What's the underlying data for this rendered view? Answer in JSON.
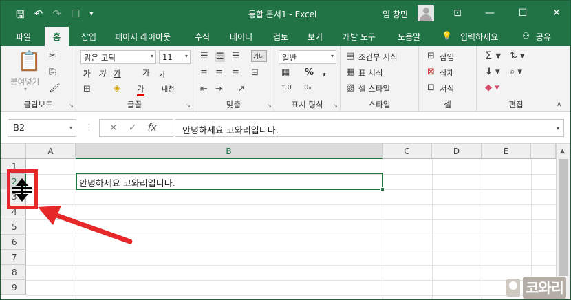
{
  "titlebar": {
    "title": "통합 문서1  -  Excel",
    "user": "임 창민",
    "qat": {
      "save_icon": "save-icon",
      "undo_icon": "undo-icon",
      "redo_icon": "redo-icon"
    }
  },
  "tabs": [
    "파일",
    "홈",
    "삽입",
    "페이지 레이아웃",
    "수식",
    "데이터",
    "검토",
    "보기",
    "개발 도구",
    "도움말",
    "입력하세요",
    "공유"
  ],
  "ribbon": {
    "clipboard": {
      "paste": "붙여넣기",
      "label": "클립보드"
    },
    "font": {
      "name": "맑은 고딕",
      "size": "11",
      "label": "글꼴",
      "ga1": "가",
      "ga2": "가",
      "ga3": "가",
      "ga4": "가",
      "ga5": "가",
      "naesum": "내천",
      "bold": "가",
      "italic": "가",
      "underline": "가"
    },
    "align": {
      "label": "맞춤",
      "wrap": "가나"
    },
    "number": {
      "format": "일반",
      "label": "표시 형식",
      "percent": "%",
      "comma": ","
    },
    "styles": {
      "cond": "조건부 서식",
      "table": "표 서식",
      "cell": "셀 스타일",
      "label": "스타일"
    },
    "cells": {
      "insert": "삽입",
      "delete": "삭제",
      "format": "서식",
      "label": "셀"
    },
    "editing": {
      "label": "편집"
    }
  },
  "formula": {
    "namebox": "B2",
    "value": "안녕하세요 코와리입니다."
  },
  "columns": [
    "A",
    "B",
    "C",
    "D",
    "E"
  ],
  "rows": [
    "1",
    "2",
    "3",
    "4",
    "5",
    "6",
    "7",
    "8",
    "9"
  ],
  "cell_b2": "안녕하세요 코와리입니다.",
  "watermark": "코와리"
}
